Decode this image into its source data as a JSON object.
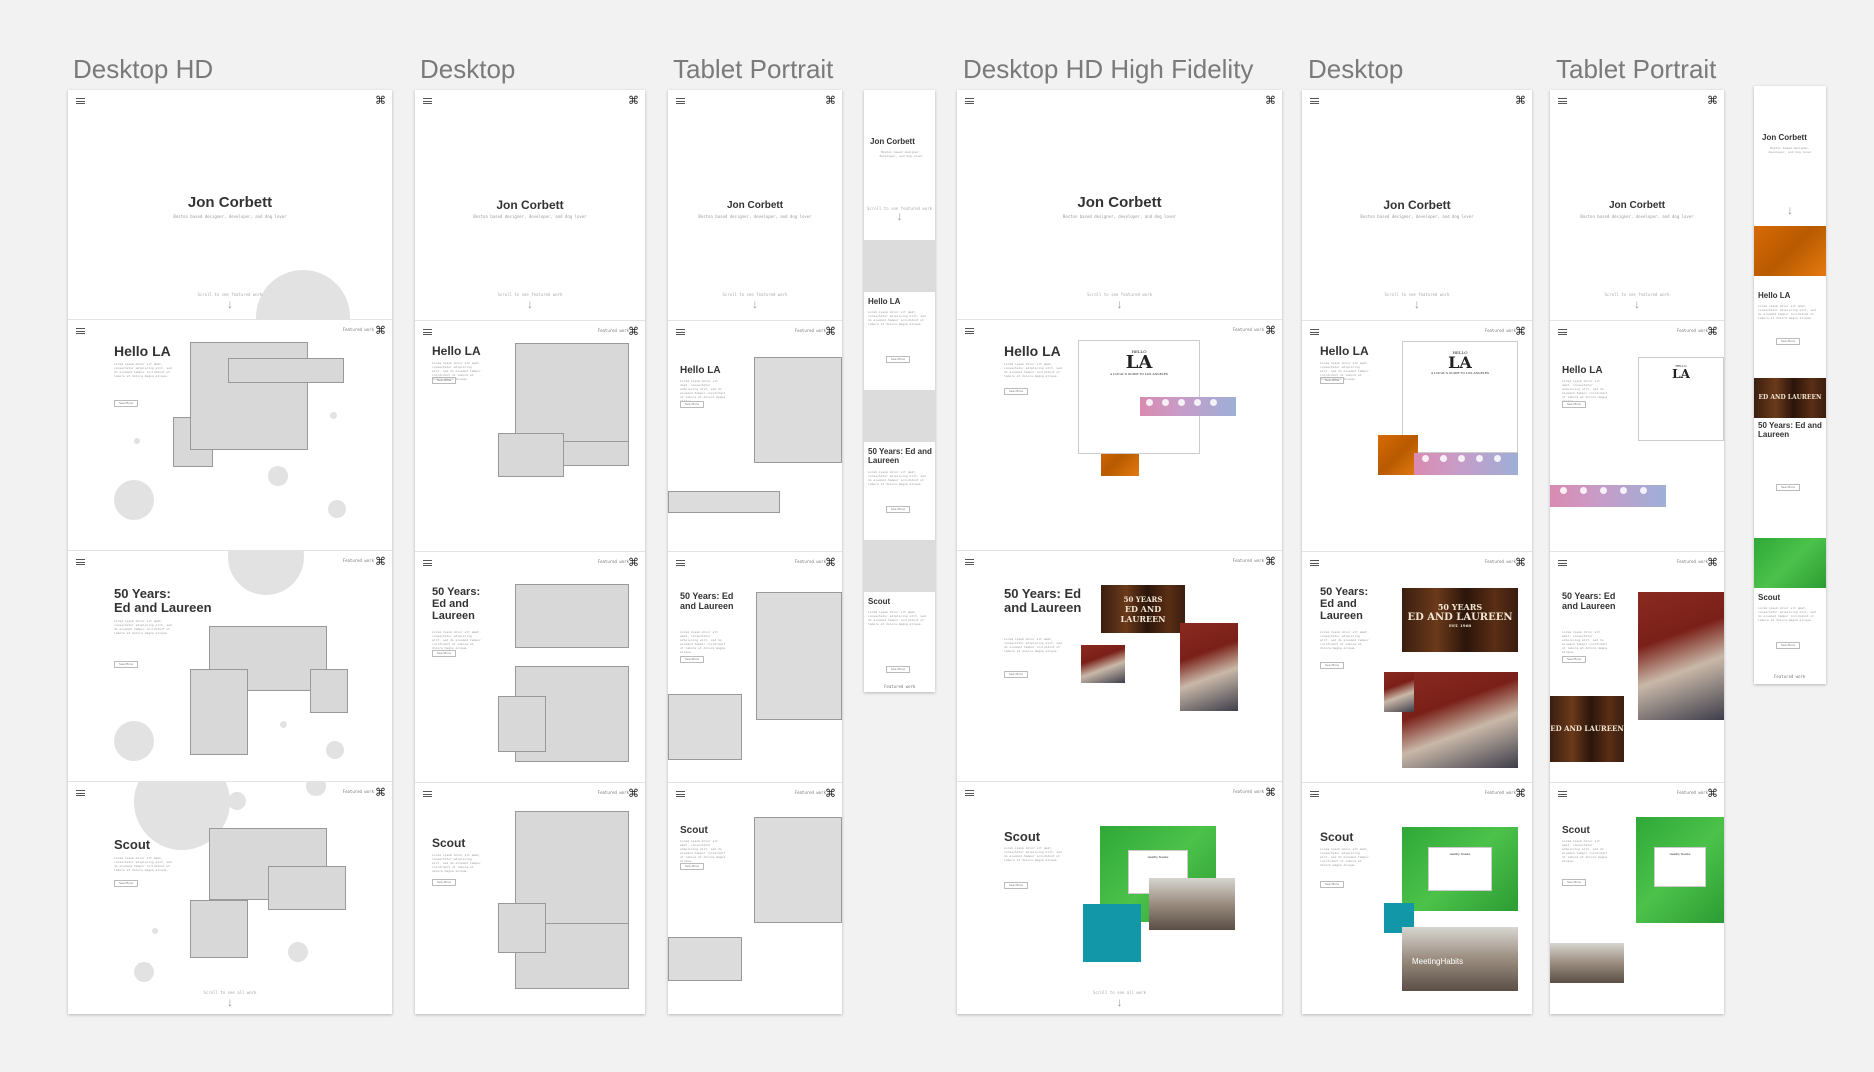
{
  "labels": {
    "desktop_hd": "Desktop HD",
    "desktop": "Desktop",
    "tablet_portrait": "Tablet Portrait",
    "desktop_hd_high_fidelity": "Desktop HD High Fidelity",
    "desktop_hf": "Desktop",
    "tablet_portrait_hf": "Tablet Portrait"
  },
  "hero": {
    "name": "Jon Corbett",
    "subtitle": "Boston based designer, developer, and dog lover",
    "scroll_hint": "Scroll to see featured work",
    "arrow": "↓"
  },
  "nav": {
    "featured_work": "Featured work",
    "logo_glyph": "⌘"
  },
  "projects": {
    "hello_la": "Hello LA",
    "fifty_years_line1": "50 Years:",
    "fifty_years_line2": "Ed and Laureen",
    "fifty_years_short": "50 Years: Ed and Laureen",
    "scout": "Scout",
    "see_more": "See More",
    "lorem": "Lorem ipsum dolor sit amet, consectetur adipiscing elit, sed do eiusmod tempor incididunt ut labore et dolore magna aliqua."
  },
  "footer": {
    "scroll_all": "Scroll to see all work"
  },
  "artwork": {
    "hello_la_card_title": "HELLO",
    "hello_la_card_big": "LA",
    "hello_la_card_sub": "A LOCAL'S GUIDE TO LOS ANGELES",
    "fifty_years_banner": "50 YEARS",
    "ed_and_laureen_banner": "ED AND LAUREEN",
    "est": "EST. 1968",
    "meeting_habits": "MeetingHabits",
    "healthy_snacks": "Healthy Snacks"
  },
  "colors": {
    "background": "#f2f2f2",
    "placeholder": "#d8d8d8",
    "orange": "#d86a05",
    "green": "#3bb33f",
    "teal": "#1197a8"
  }
}
